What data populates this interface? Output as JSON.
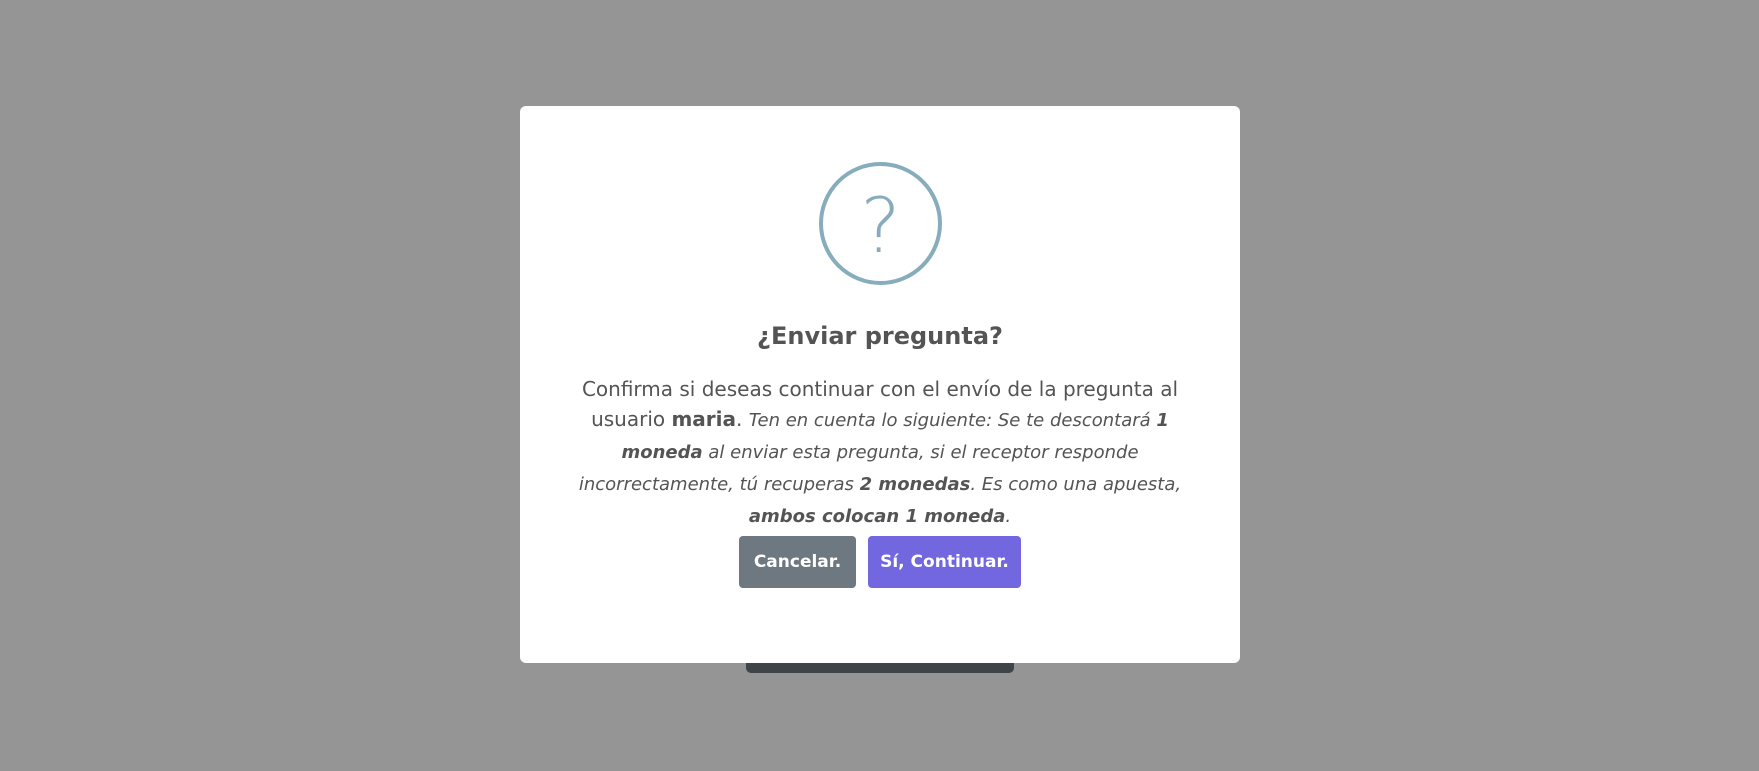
{
  "dialog": {
    "icon": "question-icon",
    "icon_glyph": "?",
    "title": "¿Enviar pregunta?",
    "message": {
      "intro": "Confirma si deseas continuar con el envío de la pregunta al usuario ",
      "username": "maria",
      "after_username": ". ",
      "notice_1": "Ten en cuenta lo siguiente: Se te descontará ",
      "cost": "1 moneda",
      "notice_2": " al enviar esta pregunta, si el receptor responde incorrectamente, tú recuperas ",
      "reward": "2 monedas",
      "notice_3": ". Es como una apuesta, ",
      "bet": "ambos colocan 1 moneda",
      "notice_4": "."
    },
    "cancel_label": "Cancelar.",
    "confirm_label": "Sí, Continuar."
  },
  "colors": {
    "backdrop": "#959595",
    "icon": "#87adbd",
    "cancel": "#6e7881",
    "confirm": "#7367e0"
  }
}
